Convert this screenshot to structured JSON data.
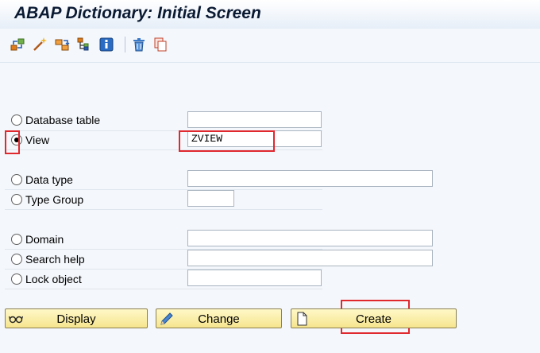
{
  "window": {
    "title": "ABAP Dictionary: Initial Screen"
  },
  "toolbar": {
    "icons": [
      "where-used-icon",
      "magic-wand-icon",
      "transport-icon",
      "hierarchy-icon",
      "info-icon",
      "trash-icon",
      "copy-icon"
    ]
  },
  "options": [
    {
      "label": "Database table",
      "value": "",
      "selected": false
    },
    {
      "label": "View",
      "value": "ZVIEW",
      "selected": true
    },
    {
      "label": "Data type",
      "value": "",
      "selected": false
    },
    {
      "label": "Type Group",
      "value": "",
      "selected": false
    },
    {
      "label": "Domain",
      "value": "",
      "selected": false
    },
    {
      "label": "Search help",
      "value": "",
      "selected": false
    },
    {
      "label": "Lock object",
      "value": "",
      "selected": false
    }
  ],
  "buttons": {
    "display": "Display",
    "change": "Change",
    "create": "Create"
  },
  "colors": {
    "highlight": "#e0282f",
    "button": "#f6e58e",
    "background": "#f4f7fb"
  }
}
